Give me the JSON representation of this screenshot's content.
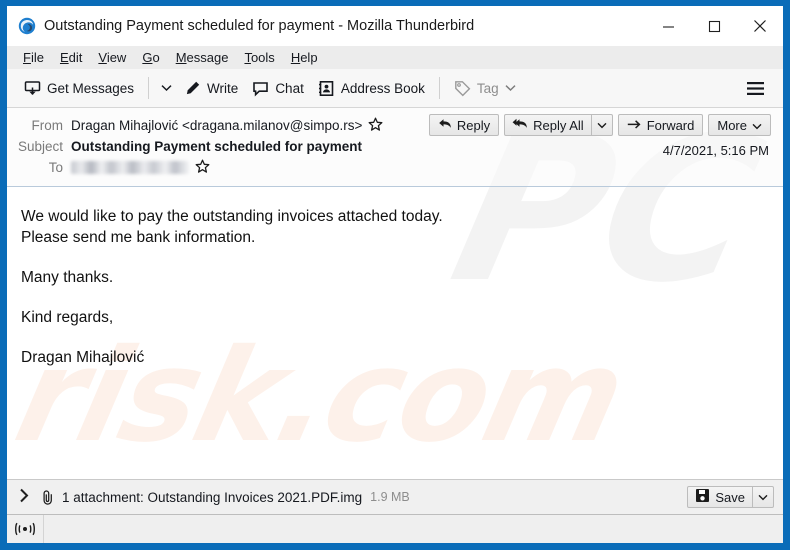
{
  "window": {
    "title": "Outstanding Payment scheduled for payment - Mozilla Thunderbird",
    "app_icon": "thunderbird-icon",
    "controls": {
      "minimize": "minimize-icon",
      "maximize": "maximize-icon",
      "close": "close-icon"
    },
    "border_color": "#0a6cb8"
  },
  "menubar": {
    "items": [
      {
        "label": "File",
        "accesskey": "F"
      },
      {
        "label": "Edit",
        "accesskey": "E"
      },
      {
        "label": "View",
        "accesskey": "V"
      },
      {
        "label": "Go",
        "accesskey": "G"
      },
      {
        "label": "Message",
        "accesskey": "M"
      },
      {
        "label": "Tools",
        "accesskey": "T"
      },
      {
        "label": "Help",
        "accesskey": "H"
      }
    ]
  },
  "toolbar": {
    "get_messages": "Get Messages",
    "write": "Write",
    "chat": "Chat",
    "address_book": "Address Book",
    "tag": "Tag",
    "app_menu": "hamburger-icon"
  },
  "message_header": {
    "from_label": "From",
    "from_value": "Dragan Mihajlović <dragana.milanov@simpo.rs>",
    "subject_label": "Subject",
    "subject_value": "Outstanding Payment scheduled for payment",
    "to_label": "To",
    "to_value": "",
    "to_redacted": true,
    "date": "4/7/2021, 5:16 PM",
    "actions": {
      "reply": "Reply",
      "reply_all": "Reply All",
      "forward": "Forward",
      "more": "More"
    }
  },
  "body": {
    "paragraphs": [
      "We would like to pay the outstanding invoices attached today.\nPlease send me bank information.",
      "Many thanks.",
      "Kind regards,",
      "Dragan Mihajlović"
    ]
  },
  "attachment": {
    "expand_icon": "chevron-right-icon",
    "clip_icon": "paperclip-icon",
    "summary": "1 attachment: Outstanding Invoices 2021.PDF.img",
    "size": "1.9 MB",
    "save_label": "Save"
  },
  "statusbar": {
    "online_icon": "online-status-icon"
  },
  "watermark": {
    "top_text": "PC",
    "bottom_text": "risk.com",
    "top_color": "#f3f3f3",
    "bottom_color": "#fdf1ea"
  }
}
